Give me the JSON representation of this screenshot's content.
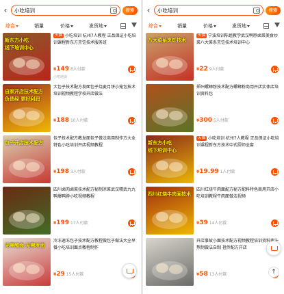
{
  "left": {
    "search": {
      "value": "小吃培训",
      "button_label": "搜索"
    },
    "filters": {
      "sort": "综合",
      "sales": "销量",
      "price": "价格",
      "location": "发货地"
    },
    "items": [
      {
        "tag": "天猫",
        "title": "小吃培训 杭州7人教程 正品保证小吃培训课程新东方烹饪技术服务班",
        "price": "149",
        "sold": "8人付款",
        "shop": "小吃培训",
        "image_text": "新东方小吃\n线下培训中心",
        "bg": "#8a5a2a",
        "accent": "#c41a1a"
      },
      {
        "tag": "",
        "title": "大包子技术配方发面包子烧麦月饼小笼包技术培训视频教程学校开店做法",
        "price": "188",
        "sold": "10人付款",
        "shop": "",
        "image_text": "自家开店技术配方\n负债经 更好利润",
        "bg": "#a3341c",
        "accent": "#ffd200"
      },
      {
        "tag": "",
        "title": "包子技术配方教发面包子做法商用制作方大全特色小吃培训开店视频教程",
        "price": "198",
        "sold": "3人付款",
        "shop": "",
        "image_text": "包子开店技术配方",
        "bg": "#d8d0b0",
        "accent": "#c41a1a"
      },
      {
        "tag": "",
        "title": "四川卤肉卤菜技术配方秘制凉菜武汉精武九九鸭爆鸭脖小吃视频教程",
        "price": "199",
        "sold": "17人付款",
        "shop": "",
        "image_text": "",
        "bg": "#6a2a14",
        "accent": "#3a7a2a"
      },
      {
        "tag": "",
        "title": "冷冻速冻包子技术配方教程做包子做法大全早餐小吃培训面点教程制作",
        "price": "29",
        "sold": "15人付款",
        "shop": "",
        "image_text": "无需醒面 无需发面",
        "bg": "#e6e0d6",
        "accent": "#c41a1a"
      }
    ]
  },
  "right": {
    "search": {
      "value": "小吃培训",
      "button_label": "搜索"
    },
    "filters": {
      "sort": "综合",
      "sales": "销量",
      "price": "价格",
      "location": "发货地"
    },
    "items": [
      {
        "tag": "天猫",
        "title": "宁波培训陈姐教学武汉鸭脖卤菜美食炒菜八大菜系烹饪技术培训中心",
        "price": "22",
        "sold": "9人付款",
        "shop": "",
        "image_text": "八大菜系烹饪技术",
        "bg": "#c9a36a",
        "accent": "#c41a1a"
      },
      {
        "tag": "",
        "title": "郑州螺蛳粉技术配方螺蛳粉商用开店实体店培训资料包",
        "price": "300",
        "sold": "5人付款",
        "shop": "",
        "image_text": "",
        "bg": "#b0501c",
        "accent": "#4a7a2a"
      },
      {
        "tag": "天猫",
        "title": "小吃培训 杭州7人教程 正品保证小吃培训课程新东方技术中式厨师全套",
        "price": "19.99",
        "sold": "1人付款",
        "shop": "",
        "image_text": "新东方小吃\n线下培训中心",
        "bg": "#8a2a1a",
        "accent": "#ffd200"
      },
      {
        "tag": "",
        "title": "四川红烧牛肉面配方秘方配料特色商用开店小吃培训教程牛肉面做法视频",
        "price": "39",
        "sold": "14人付款",
        "shop": "",
        "image_text": "四川红烧牛肉面技术",
        "bg": "#a03010",
        "accent": "#ffd200"
      },
      {
        "tag": "",
        "title": "开店事故小面技术配方视频教程培训资料酱汁熬制做法自制 祖传配方开店",
        "price": "58",
        "sold": "13人付款",
        "shop": "",
        "image_text": "",
        "bg": "#d8d6cc",
        "accent": "#555555"
      }
    ]
  }
}
